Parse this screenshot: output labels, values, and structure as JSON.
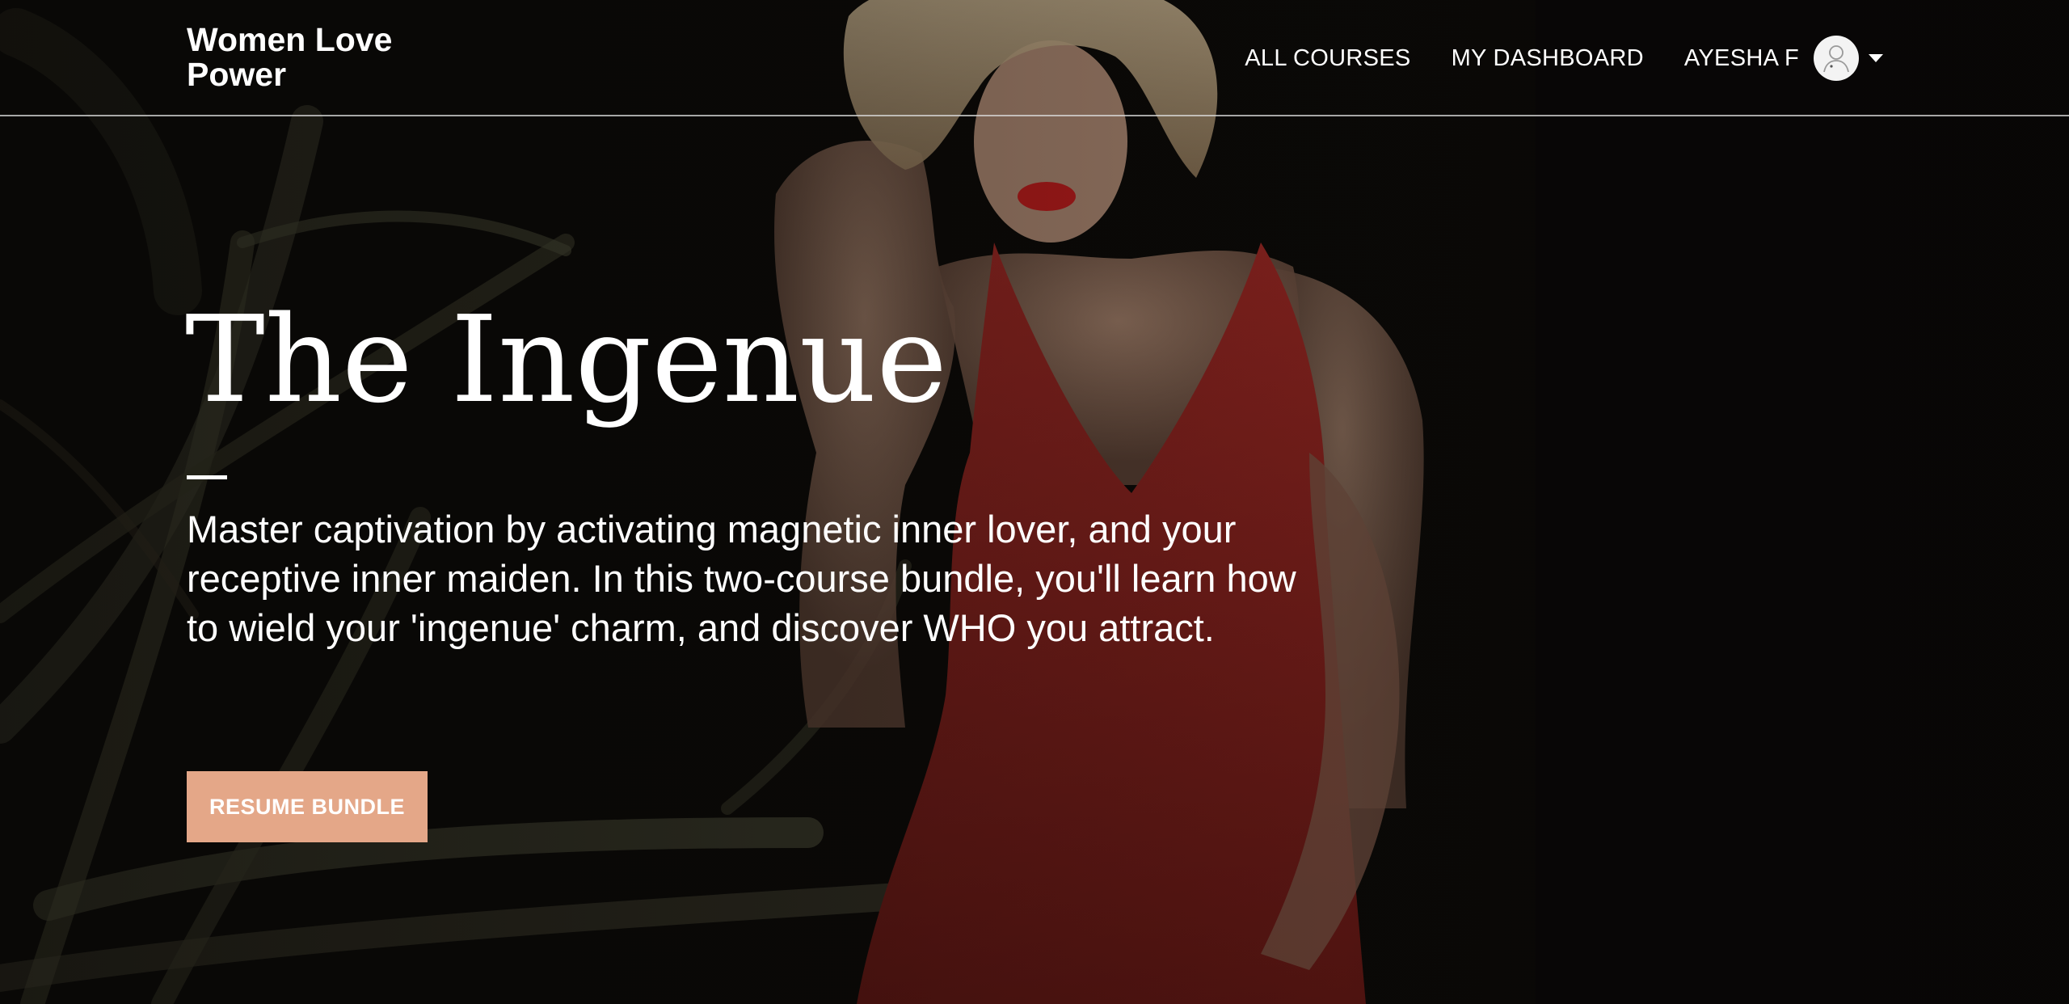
{
  "brand": {
    "line1": "Women Love",
    "line2": "Power"
  },
  "nav": {
    "all_courses": "ALL COURSES",
    "my_dashboard": "MY DASHBOARD",
    "user_name": "AYESHA F",
    "avatar_icon": "user-avatar-icon",
    "caret_icon": "caret-down-icon"
  },
  "hero": {
    "title": "The Ingenue",
    "description": "Master captivation by activating magnetic inner lover, and your receptive inner maiden. In this two-course bundle, you'll learn how to wield your 'ingenue' charm, and discover WHO you attract.",
    "button_label": "RESUME BUNDLE",
    "button_color": "#e4a788",
    "accent_dress_color": "#8a1f1c"
  }
}
